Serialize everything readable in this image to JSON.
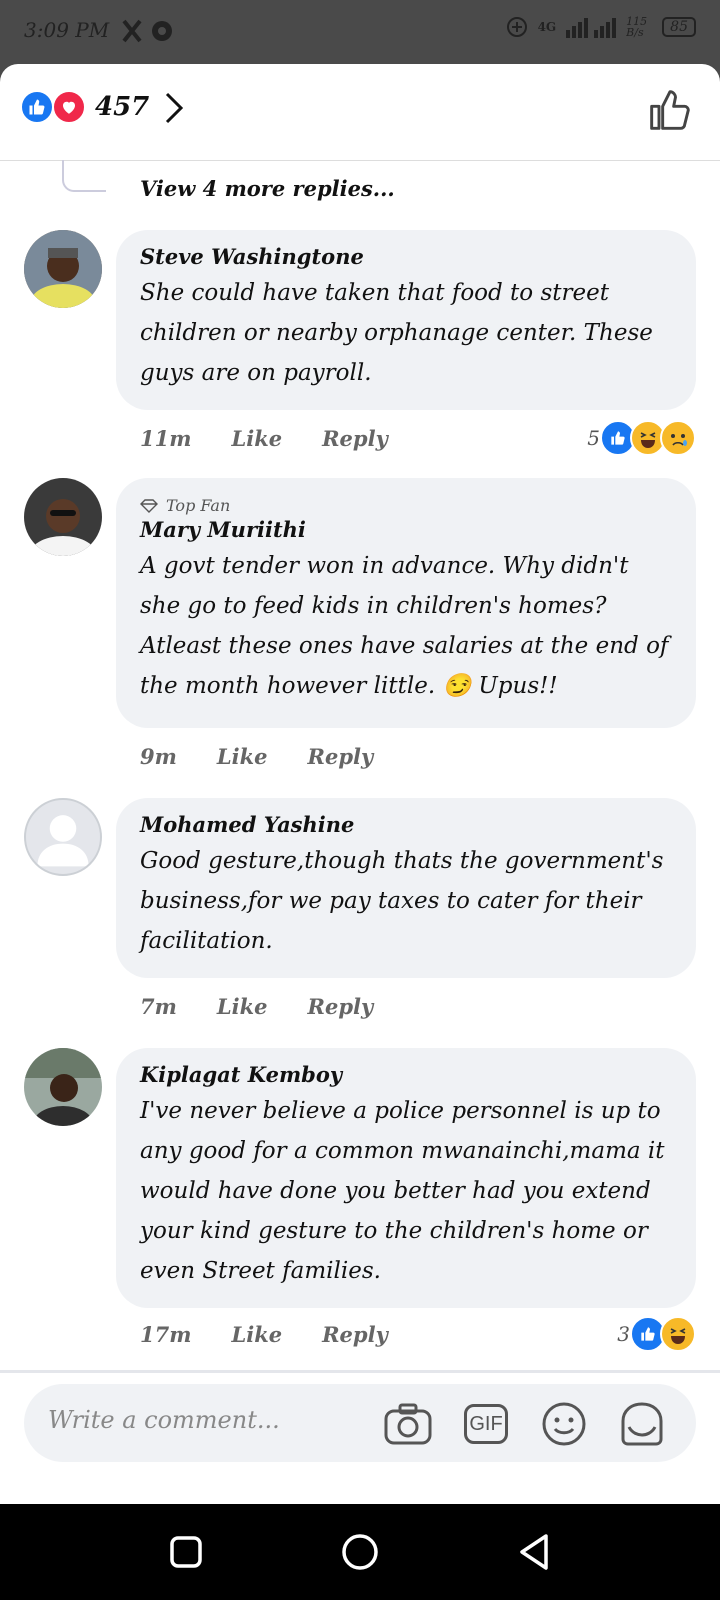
{
  "status_bar": {
    "time": "3:09 PM",
    "network": "4G",
    "data_speed": "115 B/s",
    "battery": "85"
  },
  "header": {
    "reaction_count": "457"
  },
  "thread": {
    "view_more": "View 4 more replies..."
  },
  "comments": [
    {
      "name": "Steve Washingtone",
      "text": "She could have taken that food to street children or nearby orphanage center. These guys are on payroll.",
      "time": "11m",
      "like": "Like",
      "reply": "Reply",
      "reaction_count": "5"
    },
    {
      "badge": "Top Fan",
      "name": "Mary Muriithi",
      "text": "A govt tender won in advance. Why didn't she go to feed kids in children's homes? Atleast these ones have salaries at the end of the month however little.  😏 Upus!!",
      "time": "9m",
      "like": "Like",
      "reply": "Reply"
    },
    {
      "name": "Mohamed Yashine",
      "text": "Good gesture,though thats the government's business,for we pay taxes to cater for their facilitation.",
      "time": "7m",
      "like": "Like",
      "reply": "Reply"
    },
    {
      "name": "Kiplagat Kemboy",
      "text": "I've never believe a police personnel is up to any good for a common mwanainchi,mama it would have done you better had you extend your kind gesture to the children's home or even Street families.",
      "time": "17m",
      "like": "Like",
      "reply": "Reply",
      "reaction_count": "3"
    }
  ],
  "composer": {
    "placeholder": "Write a comment...",
    "gif_label": "GIF"
  },
  "colors": {
    "like_blue": "#1877f2",
    "love_red": "#f0284a",
    "bubble_bg": "#f0f2f5"
  }
}
